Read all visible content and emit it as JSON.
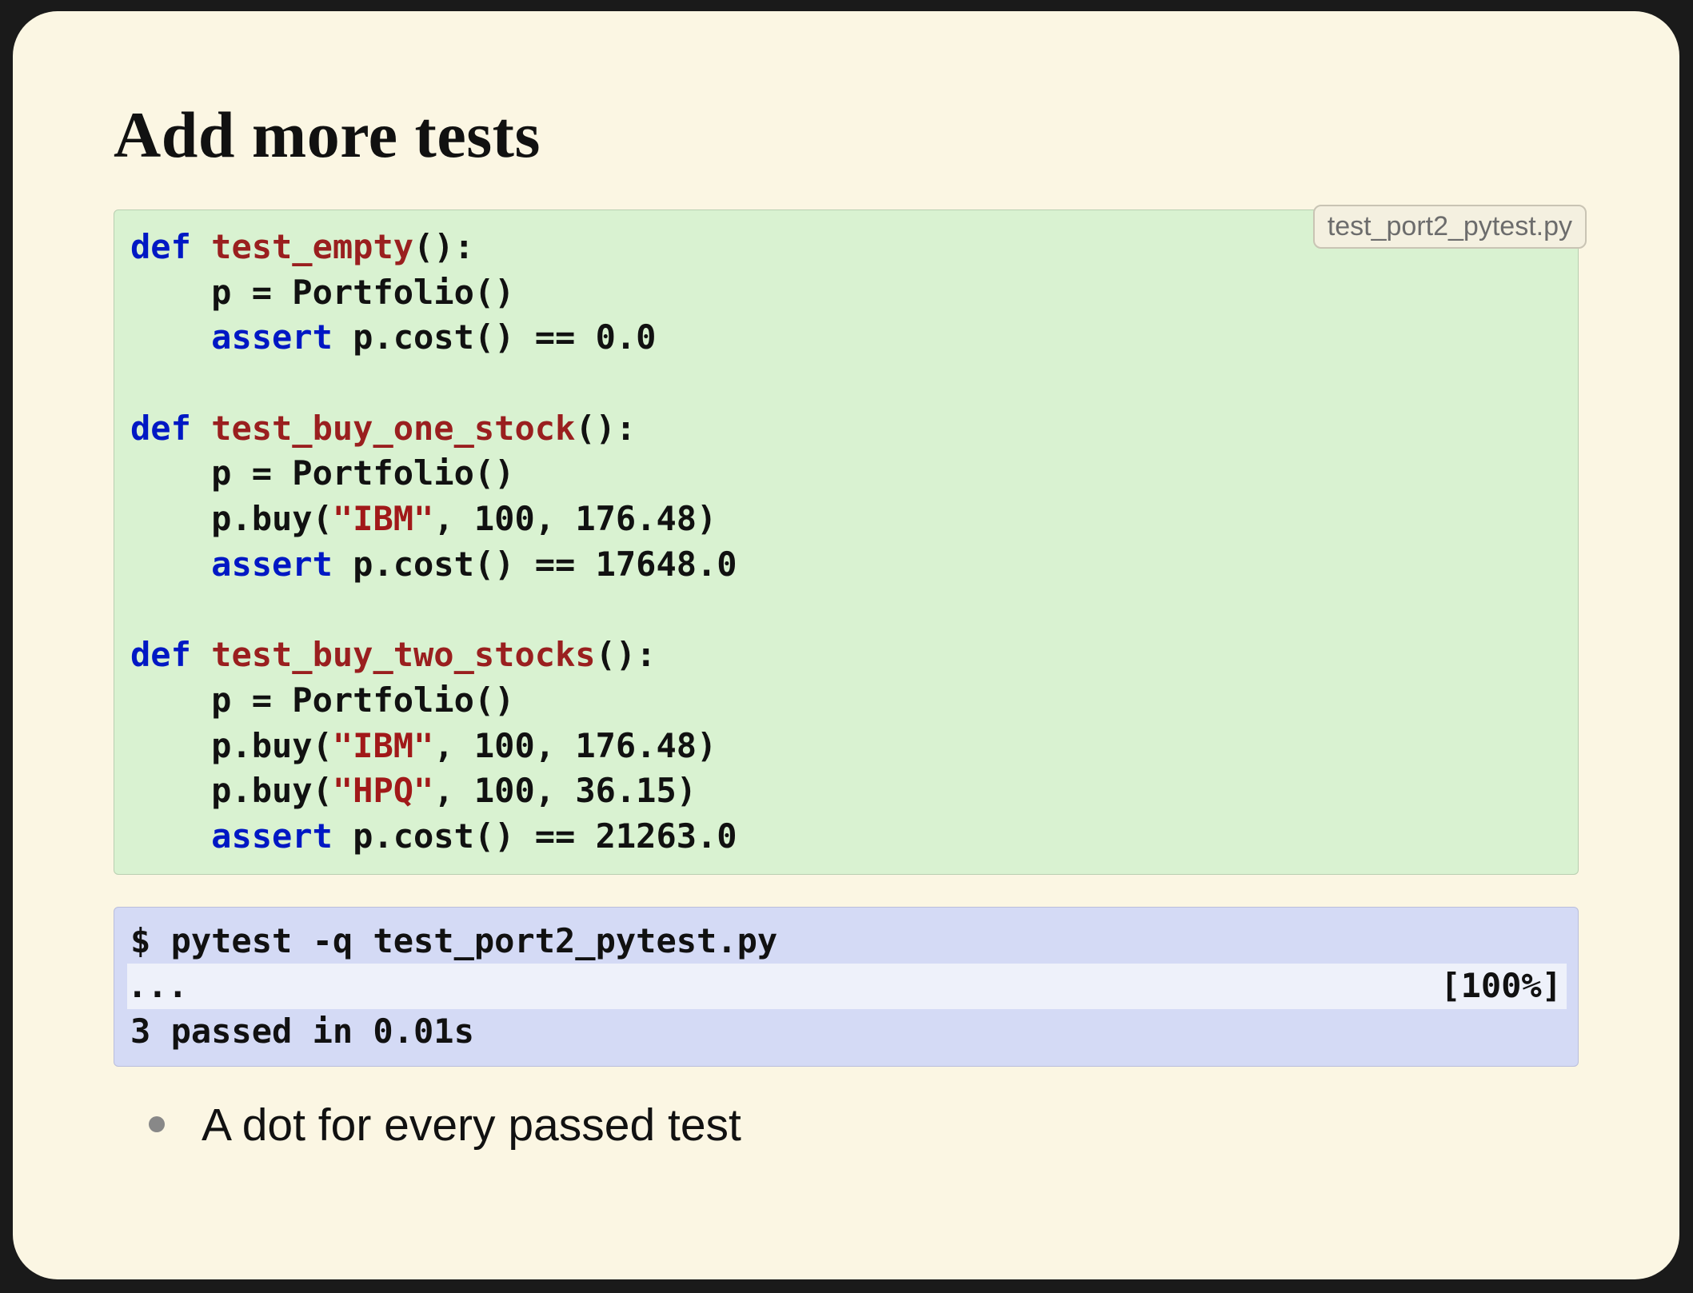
{
  "title": "Add more tests",
  "code": {
    "filename": "test_port2_pytest.py",
    "l1_def": "def",
    "l1_fn": "test_empty",
    "l1_rest": "():",
    "l2": "    p = Portfolio()",
    "l3_assert": "assert",
    "l3_rest": " p.cost() == 0.0",
    "blank": "",
    "l4_def": "def",
    "l4_fn": "test_buy_one_stock",
    "l4_rest": "():",
    "l5": "    p = Portfolio()",
    "l6a": "    p.buy(",
    "l6_str": "\"IBM\"",
    "l6b": ", 100, 176.48)",
    "l7_assert": "assert",
    "l7_rest": " p.cost() == 17648.0",
    "l8_def": "def",
    "l8_fn": "test_buy_two_stocks",
    "l8_rest": "():",
    "l9": "    p = Portfolio()",
    "l10a": "    p.buy(",
    "l10_str": "\"IBM\"",
    "l10b": ", 100, 176.48)",
    "l11a": "    p.buy(",
    "l11_str": "\"HPQ\"",
    "l11b": ", 100, 36.15)",
    "l12_assert": "assert",
    "l12_rest": " p.cost() == 21263.0",
    "indent": "    "
  },
  "terminal": {
    "cmd": "$ pytest -q test_port2_pytest.py",
    "dots": "...",
    "percent": "[100%]",
    "summary": "3 passed in 0.01s"
  },
  "bullet1": "A dot for every passed test"
}
